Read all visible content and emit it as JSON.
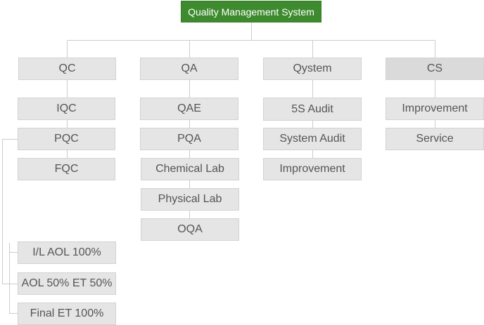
{
  "root": {
    "label": "Quality Management System",
    "color": "#3e8b2f"
  },
  "departments": [
    {
      "label": "QC",
      "children": [
        "IQC",
        "PQC",
        "FQC"
      ]
    },
    {
      "label": "QA",
      "children": [
        "QAE",
        "PQA",
        "Chemical Lab",
        "Physical Lab",
        "OQA"
      ]
    },
    {
      "label": "Qystem",
      "children": [
        "5S Audit",
        "System Audit",
        "Improvement"
      ]
    },
    {
      "label": "CS",
      "children": [
        "Improvement",
        "Service"
      ]
    }
  ],
  "pqc_children": [
    "I/L AOL 100%",
    "AOL 50% ET 50%",
    "Final ET 100%"
  ],
  "colors": {
    "box": "#e5e5e5",
    "box_border": "#d2d2d2",
    "line": "#cccccc",
    "text": "#555555"
  }
}
